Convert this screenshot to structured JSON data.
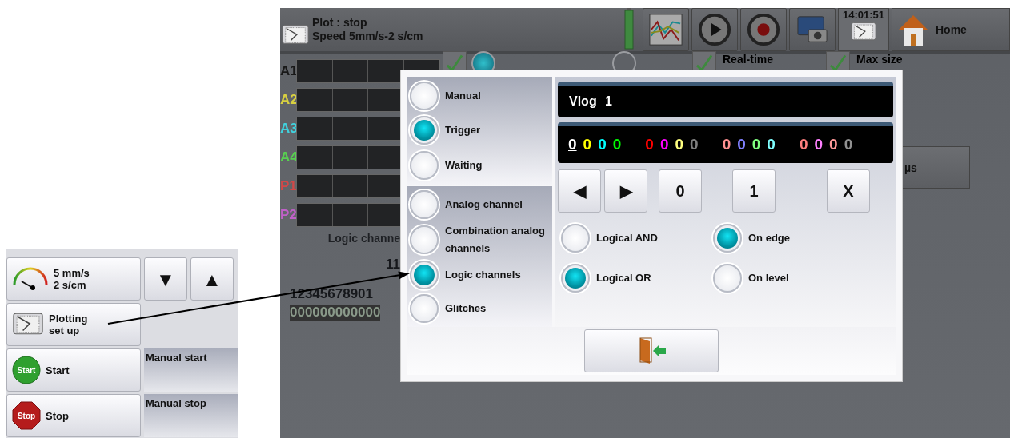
{
  "left_panel": {
    "speed_button": {
      "lines": [
        "5 mm/s",
        "2 s/cm"
      ]
    },
    "step_buttons": [
      "▼",
      "▲"
    ],
    "plotting_button": {
      "lines": [
        "Plotting",
        "set up"
      ]
    },
    "actions": [
      {
        "kind": "start",
        "icon_label": "Start",
        "label": "Start",
        "description": "Manual start"
      },
      {
        "kind": "stop",
        "icon_label": "Stop",
        "label": "Stop",
        "description": "Manual stop"
      }
    ]
  },
  "screen": {
    "status": {
      "lines": [
        "Plot : stop",
        "Speed 5mm/s-2 s/cm"
      ]
    },
    "toolbar": [
      {
        "kind": "battery"
      },
      {
        "kind": "chart"
      },
      {
        "kind": "play"
      },
      {
        "kind": "record"
      },
      {
        "kind": "capture"
      }
    ],
    "clock": "14:01:51",
    "home": {
      "label": "Home"
    },
    "channels": [
      {
        "label": "A1",
        "color": "#181818"
      },
      {
        "label": "A2",
        "color": "#d8d040"
      },
      {
        "label": "A3",
        "color": "#40d0dc"
      },
      {
        "label": "A4",
        "color": "#58d050"
      },
      {
        "label": "P1",
        "color": "#d04848"
      },
      {
        "label": "P2",
        "color": "#c060c8"
      }
    ],
    "channel_radios": [
      {
        "selected": true
      },
      {
        "selected": false
      }
    ],
    "channel_enabled": {
      "checked": true
    },
    "real_time": {
      "label": "Real-time",
      "checked": true
    },
    "max_size": {
      "label": "Max size",
      "checked": true
    },
    "unit_button": "µs",
    "logic": {
      "heading": "Logic channe",
      "tens": "11",
      "units": "12345678901",
      "values": "000000000000"
    }
  },
  "dialog": {
    "modes": [
      {
        "label": "Manual",
        "selected": false
      },
      {
        "label": "Trigger",
        "selected": true
      },
      {
        "label": "Waiting",
        "selected": false
      }
    ],
    "sources": [
      {
        "label": "Analog channel",
        "selected": false
      },
      {
        "label": "Combination analog channels",
        "selected": false
      },
      {
        "label": "Logic channels",
        "selected": true
      },
      {
        "label": "Glitches",
        "selected": false
      }
    ],
    "name_display": "Vlog 1",
    "digits": [
      {
        "text": "0",
        "color": "#ffffff",
        "selected": true
      },
      {
        "text": "0",
        "color": "#ffff00",
        "selected": false
      },
      {
        "text": "0",
        "color": "#00ffff",
        "selected": false
      },
      {
        "text": "0",
        "color": "#00ff00",
        "selected": false
      },
      {
        "text": "0",
        "color": "#ff0000",
        "selected": false
      },
      {
        "text": "0",
        "color": "#ff00ff",
        "selected": false
      },
      {
        "text": "0",
        "color": "#ffff80",
        "selected": false
      },
      {
        "text": "0",
        "color": "#808080",
        "selected": false
      },
      {
        "text": "0",
        "color": "#ff9090",
        "selected": false
      },
      {
        "text": "0",
        "color": "#8080ff",
        "selected": false
      },
      {
        "text": "0",
        "color": "#80ff80",
        "selected": false
      },
      {
        "text": "0",
        "color": "#80ffff",
        "selected": false
      },
      {
        "text": "0",
        "color": "#ff8080",
        "selected": false
      },
      {
        "text": "0",
        "color": "#ff80ff",
        "selected": false
      },
      {
        "text": "0",
        "color": "#ff9999",
        "selected": false
      },
      {
        "text": "0",
        "color": "#909090",
        "selected": false
      }
    ],
    "keys": [
      "◀",
      "▶",
      "0",
      "1",
      "X"
    ],
    "combine": [
      {
        "label": "Logical AND",
        "selected": false
      },
      {
        "label": "Logical OR",
        "selected": true
      }
    ],
    "detect": [
      {
        "label": "On edge",
        "selected": true
      },
      {
        "label": "On level",
        "selected": false
      }
    ]
  }
}
